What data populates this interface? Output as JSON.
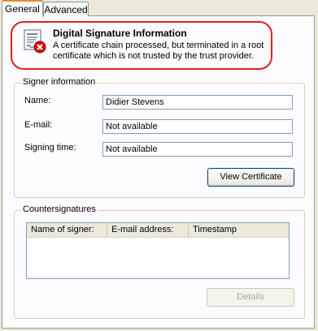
{
  "tabs": [
    {
      "label": "General",
      "active": true
    },
    {
      "label": "Advanced",
      "active": false
    }
  ],
  "info": {
    "title": "Digital Signature Information",
    "message": "A certificate chain processed, but terminated in a root certificate which is not trusted by the trust provider.",
    "icon": "certificate-error-icon",
    "highlight_color": "#e02020"
  },
  "signer": {
    "group_label": "Signer information",
    "name_label": "Name:",
    "name_value": "Didier Stevens",
    "email_label": "E-mail:",
    "email_value": "Not available",
    "time_label": "Signing time:",
    "time_value": "Not available",
    "view_cert_label": "View Certificate"
  },
  "countersignatures": {
    "group_label": "Countersignatures",
    "columns": [
      "Name of signer:",
      "E-mail address:",
      "Timestamp"
    ],
    "rows": [],
    "details_label": "Details",
    "details_enabled": false
  },
  "colors": {
    "background": "#ece9d8",
    "panel": "#fcfcfe",
    "active_tab_accent": "#e68b2c",
    "error": "#e02020"
  }
}
